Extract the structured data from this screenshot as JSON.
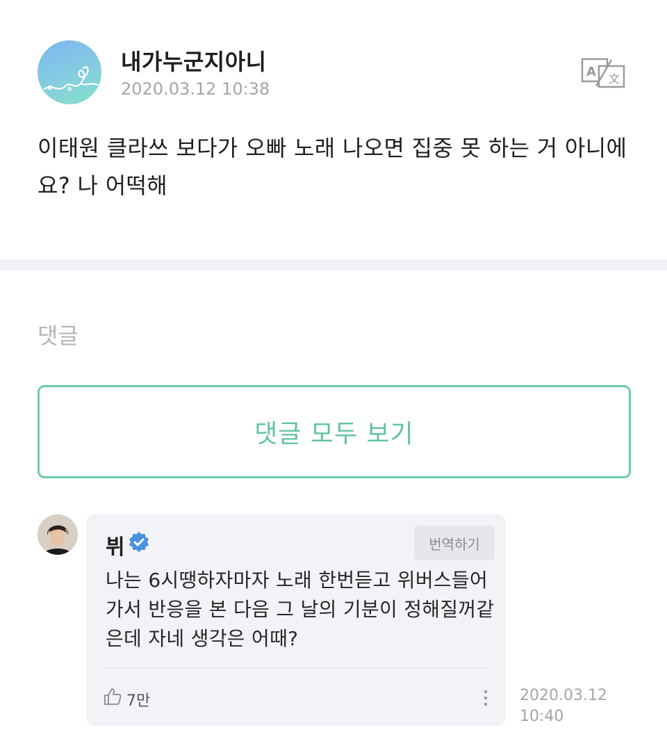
{
  "post": {
    "author": "내가누군지아니",
    "timestamp": "2020.03.12 10:38",
    "body": "이태원 클라쓰 보다가 오빠 노래 나오면 집중 못 하는 거 아니에요? 나 어떡해",
    "translate_icon": "translate-icon"
  },
  "comments_section": {
    "title": "댓글",
    "view_all_label": "댓글 모두 보기"
  },
  "comment": {
    "author": "뷔",
    "verified_icon": "verified-badge-icon",
    "translate_label": "번역하기",
    "text": "나는 6시땡하자마자 노래 한번듣고 위버스들어가서 반응을 본 다음 그 날의 기분이 정해질꺼같은데 자네 생각은 어때?",
    "like_count": "7만",
    "date": "2020.03.12",
    "time": "10:40"
  },
  "colors": {
    "accent": "#62c49d",
    "verified": "#4a90e2",
    "muted": "#a5a5a5"
  }
}
